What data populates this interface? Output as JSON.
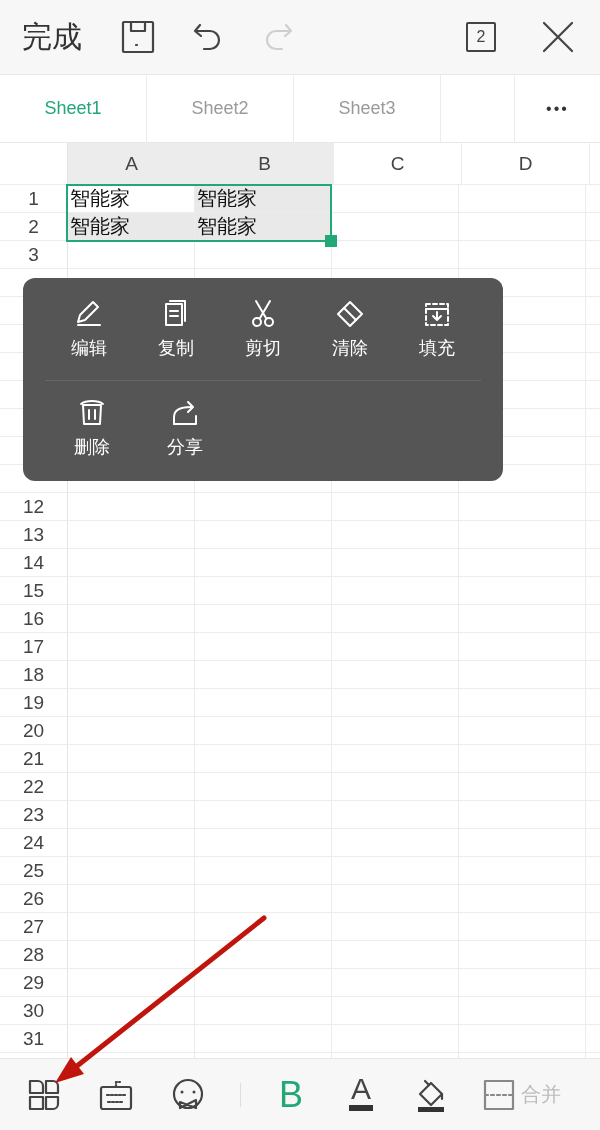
{
  "top_bar": {
    "done": "完成",
    "redo_disabled": true,
    "window_count": "2"
  },
  "sheet_tabs": [
    {
      "label": "Sheet1",
      "selected": true
    },
    {
      "label": "Sheet2",
      "selected": false
    },
    {
      "label": "Sheet3",
      "selected": false
    }
  ],
  "more": "•••",
  "columns": [
    {
      "label": "A",
      "selected": true
    },
    {
      "label": "B",
      "selected": true
    },
    {
      "label": "C",
      "selected": false
    },
    {
      "label": "D",
      "selected": false
    }
  ],
  "rows_above_menu": [
    {
      "label": "1",
      "cells": [
        {
          "value": "智能家",
          "selected": true,
          "active": true
        },
        {
          "value": "智能家",
          "selected": true,
          "active": false
        }
      ]
    },
    {
      "label": "2",
      "cells": [
        {
          "value": "智能家",
          "selected": true,
          "active": false
        },
        {
          "value": "智能家",
          "selected": true,
          "active": false
        }
      ]
    },
    {
      "label": "3"
    }
  ],
  "rows_below_menu": [
    {
      "label": "12"
    },
    {
      "label": "13"
    },
    {
      "label": "14"
    },
    {
      "label": "15"
    },
    {
      "label": "16"
    },
    {
      "label": "17"
    },
    {
      "label": "18"
    },
    {
      "label": "19"
    },
    {
      "label": "20"
    },
    {
      "label": "21"
    },
    {
      "label": "22"
    },
    {
      "label": "23"
    },
    {
      "label": "24"
    },
    {
      "label": "25"
    },
    {
      "label": "26"
    },
    {
      "label": "27"
    },
    {
      "label": "28"
    },
    {
      "label": "29"
    },
    {
      "label": "30"
    },
    {
      "label": "31"
    }
  ],
  "context_menu": [
    [
      {
        "label": "编辑"
      },
      {
        "label": "复制"
      },
      {
        "label": "剪切"
      },
      {
        "label": "清除"
      },
      {
        "label": "填充"
      }
    ],
    [
      {
        "label": "删除"
      },
      {
        "label": "分享"
      }
    ]
  ],
  "toolbar": {
    "bold": {
      "label": "B",
      "on": true
    },
    "font_color": {
      "label": "A"
    },
    "merge": {
      "label": "合并",
      "disabled": true
    }
  }
}
